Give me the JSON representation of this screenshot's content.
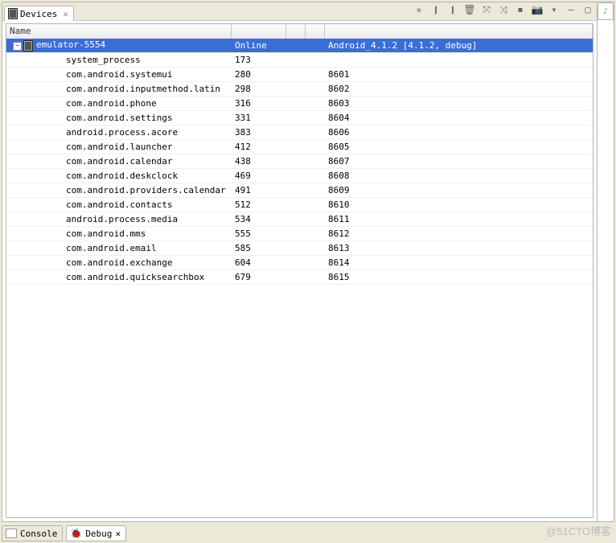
{
  "tabs": {
    "devices": {
      "label": "Devices"
    }
  },
  "toolbar_icons": [
    {
      "name": "debug-icon",
      "glyph": "✳"
    },
    {
      "name": "snapshot-icon",
      "glyph": "❙"
    },
    {
      "name": "update-heap-icon",
      "glyph": "❙"
    },
    {
      "name": "dump-icon",
      "glyph": "🗑"
    },
    {
      "name": "thread-icon",
      "glyph": "⤧"
    },
    {
      "name": "method-icon",
      "glyph": "⤨"
    },
    {
      "name": "stop-icon",
      "glyph": "⏹"
    },
    {
      "name": "capture-icon",
      "glyph": "📷"
    },
    {
      "name": "menu-icon",
      "glyph": "▾"
    },
    {
      "name": "minimize-icon",
      "glyph": "—"
    },
    {
      "name": "maximize-icon",
      "glyph": "▢"
    }
  ],
  "columns": {
    "name": "Name",
    "status": "",
    "blank1": "",
    "blank2": "",
    "detail": ""
  },
  "device_row": {
    "name": "emulator-5554",
    "status": "Online",
    "detail": "Android_4.1.2 [4.1.2, debug]"
  },
  "processes": [
    {
      "name": "system_process",
      "pid": "173",
      "port": ""
    },
    {
      "name": "com.android.systemui",
      "pid": "280",
      "port": "8601"
    },
    {
      "name": "com.android.inputmethod.latin",
      "pid": "298",
      "port": "8602"
    },
    {
      "name": "com.android.phone",
      "pid": "316",
      "port": "8603"
    },
    {
      "name": "com.android.settings",
      "pid": "331",
      "port": "8604"
    },
    {
      "name": "android.process.acore",
      "pid": "383",
      "port": "8606"
    },
    {
      "name": "com.android.launcher",
      "pid": "412",
      "port": "8605"
    },
    {
      "name": "com.android.calendar",
      "pid": "438",
      "port": "8607"
    },
    {
      "name": "com.android.deskclock",
      "pid": "469",
      "port": "8608"
    },
    {
      "name": "com.android.providers.calendar",
      "pid": "491",
      "port": "8609"
    },
    {
      "name": "com.android.contacts",
      "pid": "512",
      "port": "8610"
    },
    {
      "name": "android.process.media",
      "pid": "534",
      "port": "8611"
    },
    {
      "name": "com.android.mms",
      "pid": "555",
      "port": "8612"
    },
    {
      "name": "com.android.email",
      "pid": "585",
      "port": "8613"
    },
    {
      "name": "com.android.exchange",
      "pid": "604",
      "port": "8614"
    },
    {
      "name": "com.android.quicksearchbox",
      "pid": "679",
      "port": "8615"
    }
  ],
  "bottom_tabs": {
    "console": "Console",
    "debug": "Debug"
  },
  "watermark": "@51CTO博客"
}
